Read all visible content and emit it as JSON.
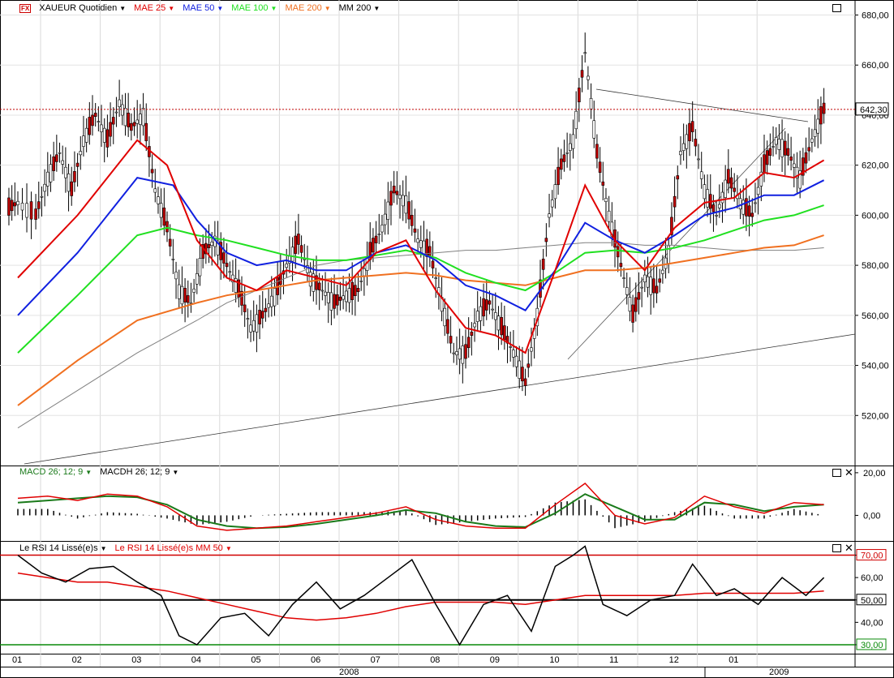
{
  "colors": {
    "red": "#e00000",
    "blue": "#1020e0",
    "green": "#20e020",
    "orange": "#f07020",
    "gray": "#808080",
    "dotted": "#c00000",
    "macd_green": "#1a7a1a",
    "rsi_red": "#e00000"
  },
  "price_panel": {
    "symbol": "XAUEUR Quotidien",
    "fx_label": "FX",
    "legend": [
      {
        "label": "MAE 25",
        "color": "#e00000"
      },
      {
        "label": "MAE 50",
        "color": "#1020e0"
      },
      {
        "label": "MAE 100",
        "color": "#20e020"
      },
      {
        "label": "MAE 200",
        "color": "#f07020"
      },
      {
        "label": "MM 200",
        "color": "#000000"
      }
    ],
    "current_price": "642,30"
  },
  "macd_panel": {
    "legend": [
      {
        "label": "MACD  26; 12; 9",
        "color": "#1a7a1a"
      },
      {
        "label": "MACDH 26; 12; 9",
        "color": "#000000"
      }
    ]
  },
  "rsi_panel": {
    "legend": [
      {
        "label": "Le RSI 14 Lissé(e)s",
        "color": "#000000"
      },
      {
        "label": "Le RSI 14 Lissé(e)s MM 50",
        "color": "#e00000"
      }
    ],
    "levels": [
      "70,00",
      "50,00",
      "30,00"
    ]
  },
  "chart_data": {
    "type": "line",
    "x_months": [
      "01",
      "02",
      "03",
      "04",
      "05",
      "06",
      "07",
      "08",
      "09",
      "10",
      "11",
      "12",
      "01"
    ],
    "x_years": [
      "2008",
      "2009"
    ],
    "price_axis_ticks": [
      "680,00",
      "660,00",
      "640,00",
      "620,00",
      "600,00",
      "580,00",
      "560,00",
      "540,00",
      "520,00"
    ],
    "price_ylim": [
      500,
      686
    ],
    "macd_axis_ticks": [
      "20,00",
      "0,00"
    ],
    "macd_ylim": [
      -12,
      23
    ],
    "rsi_axis_ticks": [
      "70,00",
      "60,00",
      "50,00",
      "40,00",
      "30,00"
    ],
    "rsi_ylim": [
      26,
      76
    ],
    "series_price": [
      {
        "month": 0.0,
        "close": 605
      },
      {
        "month": 0.3,
        "close": 600
      },
      {
        "month": 0.5,
        "close": 615
      },
      {
        "month": 0.7,
        "close": 625
      },
      {
        "month": 0.9,
        "close": 610
      },
      {
        "month": 1.1,
        "close": 630
      },
      {
        "month": 1.3,
        "close": 640
      },
      {
        "month": 1.5,
        "close": 630
      },
      {
        "month": 1.7,
        "close": 645
      },
      {
        "month": 1.9,
        "close": 635
      },
      {
        "month": 2.1,
        "close": 640
      },
      {
        "month": 2.3,
        "close": 610
      },
      {
        "month": 2.5,
        "close": 595
      },
      {
        "month": 2.7,
        "close": 570
      },
      {
        "month": 2.9,
        "close": 565
      },
      {
        "month": 3.1,
        "close": 585
      },
      {
        "month": 3.3,
        "close": 590
      },
      {
        "month": 3.5,
        "close": 580
      },
      {
        "month": 3.7,
        "close": 570
      },
      {
        "month": 3.9,
        "close": 555
      },
      {
        "month": 4.1,
        "close": 560
      },
      {
        "month": 4.3,
        "close": 568
      },
      {
        "month": 4.5,
        "close": 580
      },
      {
        "month": 4.7,
        "close": 590
      },
      {
        "month": 4.9,
        "close": 575
      },
      {
        "month": 5.1,
        "close": 570
      },
      {
        "month": 5.3,
        "close": 565
      },
      {
        "month": 5.5,
        "close": 568
      },
      {
        "month": 5.7,
        "close": 570
      },
      {
        "month": 5.9,
        "close": 585
      },
      {
        "month": 6.1,
        "close": 595
      },
      {
        "month": 6.3,
        "close": 610
      },
      {
        "month": 6.5,
        "close": 605
      },
      {
        "month": 6.7,
        "close": 590
      },
      {
        "month": 6.9,
        "close": 585
      },
      {
        "month": 7.1,
        "close": 565
      },
      {
        "month": 7.3,
        "close": 545
      },
      {
        "month": 7.5,
        "close": 545
      },
      {
        "month": 7.7,
        "close": 560
      },
      {
        "month": 7.9,
        "close": 565
      },
      {
        "month": 8.1,
        "close": 555
      },
      {
        "month": 8.3,
        "close": 545
      },
      {
        "month": 8.5,
        "close": 533
      },
      {
        "month": 8.7,
        "close": 560
      },
      {
        "month": 8.9,
        "close": 600
      },
      {
        "month": 9.1,
        "close": 620
      },
      {
        "month": 9.3,
        "close": 630
      },
      {
        "month": 9.5,
        "close": 665
      },
      {
        "month": 9.7,
        "close": 625
      },
      {
        "month": 9.9,
        "close": 600
      },
      {
        "month": 10.1,
        "close": 580
      },
      {
        "month": 10.3,
        "close": 560
      },
      {
        "month": 10.5,
        "close": 575
      },
      {
        "month": 10.7,
        "close": 570
      },
      {
        "month": 10.9,
        "close": 585
      },
      {
        "month": 11.1,
        "close": 625
      },
      {
        "month": 11.3,
        "close": 635
      },
      {
        "month": 11.5,
        "close": 610
      },
      {
        "month": 11.7,
        "close": 600
      },
      {
        "month": 11.9,
        "close": 615
      },
      {
        "month": 12.1,
        "close": 605
      },
      {
        "month": 12.3,
        "close": 600
      },
      {
        "month": 12.5,
        "close": 620
      },
      {
        "month": 12.7,
        "close": 630
      },
      {
        "month": 12.9,
        "close": 625
      },
      {
        "month": 13.1,
        "close": 615
      },
      {
        "month": 13.3,
        "close": 630
      },
      {
        "month": 13.5,
        "close": 642.3
      }
    ],
    "series_mae25": [
      [
        0,
        575
      ],
      [
        1,
        600
      ],
      [
        2,
        630
      ],
      [
        2.5,
        620
      ],
      [
        3,
        590
      ],
      [
        3.5,
        575
      ],
      [
        4,
        570
      ],
      [
        4.5,
        578
      ],
      [
        5,
        575
      ],
      [
        5.5,
        572
      ],
      [
        6,
        585
      ],
      [
        6.5,
        590
      ],
      [
        7,
        570
      ],
      [
        7.5,
        555
      ],
      [
        8,
        552
      ],
      [
        8.5,
        545
      ],
      [
        9,
        578
      ],
      [
        9.5,
        612
      ],
      [
        10,
        590
      ],
      [
        10.5,
        578
      ],
      [
        11,
        595
      ],
      [
        11.5,
        605
      ],
      [
        12,
        607
      ],
      [
        12.5,
        617
      ],
      [
        13,
        615
      ],
      [
        13.5,
        622
      ]
    ],
    "series_mae50": [
      [
        0,
        560
      ],
      [
        1,
        585
      ],
      [
        2,
        615
      ],
      [
        2.6,
        612
      ],
      [
        3,
        598
      ],
      [
        3.5,
        585
      ],
      [
        4,
        580
      ],
      [
        4.5,
        582
      ],
      [
        5,
        578
      ],
      [
        5.5,
        578
      ],
      [
        6,
        585
      ],
      [
        6.5,
        588
      ],
      [
        7,
        582
      ],
      [
        7.5,
        572
      ],
      [
        8,
        568
      ],
      [
        8.5,
        562
      ],
      [
        9,
        578
      ],
      [
        9.5,
        597
      ],
      [
        10,
        590
      ],
      [
        10.5,
        585
      ],
      [
        11,
        592
      ],
      [
        11.5,
        600
      ],
      [
        12,
        603
      ],
      [
        12.5,
        608
      ],
      [
        13,
        608
      ],
      [
        13.5,
        614
      ]
    ],
    "series_mae100": [
      [
        0,
        545
      ],
      [
        1,
        568
      ],
      [
        2,
        592
      ],
      [
        2.5,
        595
      ],
      [
        3,
        592
      ],
      [
        3.5,
        590
      ],
      [
        4,
        587
      ],
      [
        4.5,
        584
      ],
      [
        5,
        582
      ],
      [
        5.5,
        582
      ],
      [
        6,
        584
      ],
      [
        6.5,
        586
      ],
      [
        7,
        583
      ],
      [
        7.5,
        577
      ],
      [
        8,
        573
      ],
      [
        8.5,
        570
      ],
      [
        9,
        577
      ],
      [
        9.5,
        585
      ],
      [
        10,
        586
      ],
      [
        10.5,
        585
      ],
      [
        11,
        587
      ],
      [
        11.5,
        590
      ],
      [
        12,
        594
      ],
      [
        12.5,
        598
      ],
      [
        13,
        600
      ],
      [
        13.5,
        604
      ]
    ],
    "series_mae200": [
      [
        0,
        524
      ],
      [
        1,
        542
      ],
      [
        2,
        558
      ],
      [
        3,
        565
      ],
      [
        3.5,
        568
      ],
      [
        4,
        570
      ],
      [
        4.5,
        572
      ],
      [
        5,
        574
      ],
      [
        5.5,
        575
      ],
      [
        6,
        576
      ],
      [
        6.5,
        577
      ],
      [
        7,
        576
      ],
      [
        7.5,
        574
      ],
      [
        8,
        573
      ],
      [
        8.5,
        572
      ],
      [
        9,
        575
      ],
      [
        9.5,
        578
      ],
      [
        10,
        578
      ],
      [
        10.5,
        579
      ],
      [
        11,
        581
      ],
      [
        11.5,
        583
      ],
      [
        12,
        585
      ],
      [
        12.5,
        587
      ],
      [
        13,
        588
      ],
      [
        13.5,
        592
      ]
    ],
    "series_mm200": [
      [
        0,
        515
      ],
      [
        1,
        530
      ],
      [
        2,
        545
      ],
      [
        3,
        558
      ],
      [
        3.5,
        565
      ],
      [
        4,
        570
      ],
      [
        4.5,
        575
      ],
      [
        5,
        580
      ],
      [
        5.5,
        582
      ],
      [
        6,
        583
      ],
      [
        6.5,
        584
      ],
      [
        7,
        585
      ],
      [
        7.5,
        586
      ],
      [
        8,
        586
      ],
      [
        8.5,
        587
      ],
      [
        9,
        588
      ],
      [
        9.5,
        589
      ],
      [
        10,
        589
      ],
      [
        10.5,
        588
      ],
      [
        11,
        588
      ],
      [
        11.5,
        587
      ],
      [
        12,
        586
      ],
      [
        12.5,
        586
      ],
      [
        13,
        586
      ],
      [
        13.5,
        587
      ]
    ],
    "macd_line": [
      [
        0,
        8
      ],
      [
        0.5,
        9
      ],
      [
        1,
        7
      ],
      [
        1.5,
        10
      ],
      [
        2,
        9
      ],
      [
        2.5,
        4
      ],
      [
        3,
        -5
      ],
      [
        3.5,
        -7
      ],
      [
        4,
        -6
      ],
      [
        4.5,
        -5
      ],
      [
        5,
        -3
      ],
      [
        5.5,
        -1
      ],
      [
        6,
        1
      ],
      [
        6.5,
        4
      ],
      [
        7,
        -2
      ],
      [
        7.5,
        -5
      ],
      [
        8,
        -6
      ],
      [
        8.5,
        -6
      ],
      [
        9,
        5
      ],
      [
        9.5,
        15
      ],
      [
        10,
        0
      ],
      [
        10.5,
        -4
      ],
      [
        11,
        -1
      ],
      [
        11.5,
        9
      ],
      [
        12,
        4
      ],
      [
        12.5,
        1
      ],
      [
        13,
        6
      ],
      [
        13.5,
        5
      ]
    ],
    "macd_signal": [
      [
        0,
        6
      ],
      [
        0.5,
        7
      ],
      [
        1,
        8
      ],
      [
        1.5,
        9
      ],
      [
        2,
        8.5
      ],
      [
        2.5,
        5
      ],
      [
        3,
        -2
      ],
      [
        3.5,
        -5
      ],
      [
        4,
        -6
      ],
      [
        4.5,
        -5.5
      ],
      [
        5,
        -4
      ],
      [
        5.5,
        -2
      ],
      [
        6,
        0
      ],
      [
        6.5,
        2.5
      ],
      [
        7,
        1
      ],
      [
        7.5,
        -3
      ],
      [
        8,
        -5
      ],
      [
        8.5,
        -5.5
      ],
      [
        9,
        1
      ],
      [
        9.5,
        10
      ],
      [
        10,
        4
      ],
      [
        10.5,
        -2
      ],
      [
        11,
        -2
      ],
      [
        11.5,
        6
      ],
      [
        12,
        5
      ],
      [
        12.5,
        2
      ],
      [
        13,
        4
      ],
      [
        13.5,
        5
      ]
    ],
    "rsi_line": [
      [
        0,
        70
      ],
      [
        0.4,
        62
      ],
      [
        0.8,
        58
      ],
      [
        1.2,
        64
      ],
      [
        1.6,
        65
      ],
      [
        2,
        58
      ],
      [
        2.4,
        52
      ],
      [
        2.7,
        34
      ],
      [
        3,
        30
      ],
      [
        3.4,
        42
      ],
      [
        3.8,
        44
      ],
      [
        4.2,
        34
      ],
      [
        4.6,
        48
      ],
      [
        5,
        58
      ],
      [
        5.4,
        46
      ],
      [
        5.8,
        52
      ],
      [
        6.2,
        60
      ],
      [
        6.6,
        68
      ],
      [
        7,
        48
      ],
      [
        7.4,
        30
      ],
      [
        7.8,
        48
      ],
      [
        8.2,
        52
      ],
      [
        8.6,
        36
      ],
      [
        9,
        65
      ],
      [
        9.3,
        70
      ],
      [
        9.5,
        74
      ],
      [
        9.8,
        48
      ],
      [
        10.2,
        43
      ],
      [
        10.6,
        50
      ],
      [
        11,
        52
      ],
      [
        11.3,
        66
      ],
      [
        11.7,
        52
      ],
      [
        12,
        55
      ],
      [
        12.4,
        48
      ],
      [
        12.8,
        60
      ],
      [
        13.2,
        52
      ],
      [
        13.5,
        60
      ]
    ],
    "rsi_signal": [
      [
        0,
        62
      ],
      [
        0.5,
        60
      ],
      [
        1,
        58
      ],
      [
        1.5,
        58
      ],
      [
        2,
        56
      ],
      [
        2.5,
        54
      ],
      [
        3,
        51
      ],
      [
        3.5,
        48
      ],
      [
        4,
        45
      ],
      [
        4.5,
        42
      ],
      [
        5,
        41
      ],
      [
        5.5,
        42
      ],
      [
        6,
        44
      ],
      [
        6.5,
        47
      ],
      [
        7,
        49
      ],
      [
        7.5,
        49
      ],
      [
        8,
        49
      ],
      [
        8.5,
        48
      ],
      [
        9,
        50
      ],
      [
        9.5,
        52
      ],
      [
        10,
        52
      ],
      [
        10.5,
        52
      ],
      [
        11,
        52
      ],
      [
        11.5,
        53
      ],
      [
        12,
        53
      ],
      [
        12.5,
        53
      ],
      [
        13,
        53
      ],
      [
        13.5,
        54
      ]
    ]
  }
}
